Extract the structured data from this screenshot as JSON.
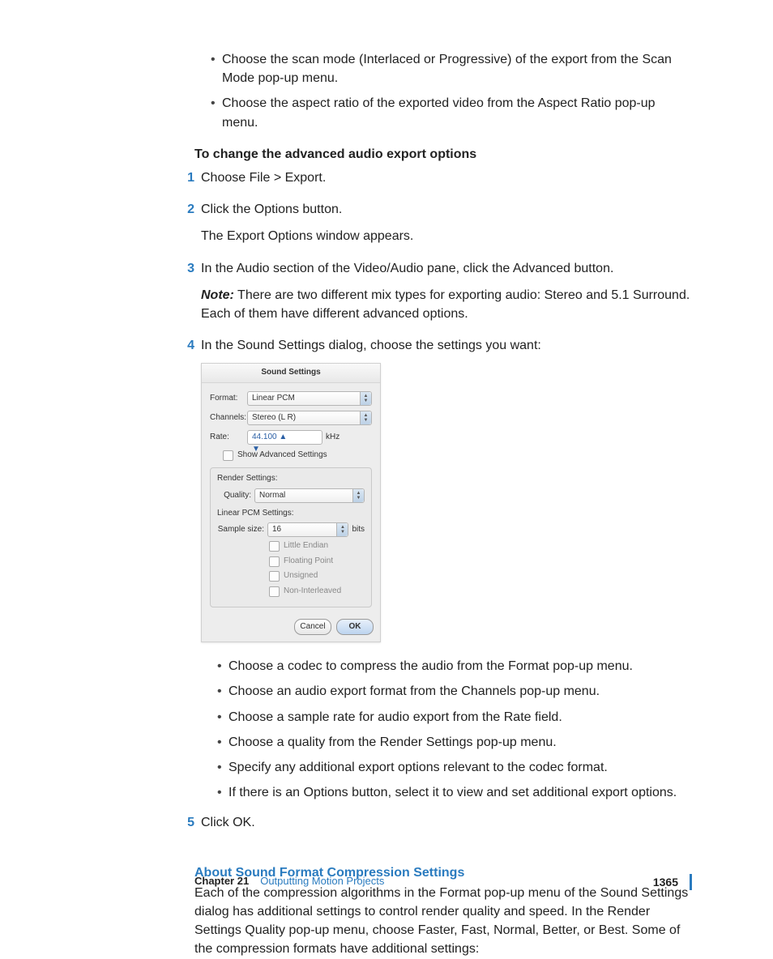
{
  "intro_bullets": [
    "Choose the scan mode (Interlaced or Progressive) of the export from the Scan Mode pop-up menu.",
    "Choose the aspect ratio of the exported video from the Aspect Ratio pop-up menu."
  ],
  "heading_audio": "To change the advanced audio export options",
  "steps": {
    "s1": {
      "num": "1",
      "text": "Choose File > Export."
    },
    "s2": {
      "num": "2",
      "text": "Click the Options button.",
      "after": "The Export Options window appears."
    },
    "s3": {
      "num": "3",
      "text": "In the Audio section of the Video/Audio pane, click the Advanced button.",
      "note_label": "Note:",
      "note_text": "  There are two different mix types for exporting audio: Stereo and 5.1 Surround. Each of them have different advanced options."
    },
    "s4": {
      "num": "4",
      "text": "In the Sound Settings dialog, choose the settings you want:"
    },
    "s5": {
      "num": "5",
      "text": "Click OK."
    }
  },
  "dialog": {
    "title": "Sound Settings",
    "format_label": "Format:",
    "format_value": "Linear PCM",
    "channels_label": "Channels:",
    "channels_value": "Stereo (L R)",
    "rate_label": "Rate:",
    "rate_value": "44.100",
    "rate_unit": "kHz",
    "show_advanced": "Show Advanced Settings",
    "render_group": "Render Settings:",
    "quality_label": "Quality:",
    "quality_value": "Normal",
    "pcm_group": "Linear PCM Settings:",
    "sample_label": "Sample size:",
    "sample_value": "16",
    "sample_unit": "bits",
    "chk_little": "Little Endian",
    "chk_float": "Floating Point",
    "chk_unsigned": "Unsigned",
    "chk_noninter": "Non-Interleaved",
    "cancel": "Cancel",
    "ok": "OK"
  },
  "post_bullets": [
    "Choose a codec to compress the audio from the Format pop-up menu.",
    "Choose an audio export format from the Channels pop-up menu.",
    "Choose a sample rate for audio export from the Rate field.",
    "Choose a quality from the Render Settings pop-up menu.",
    "Specify any additional export options relevant to the codec format.",
    "If there is an Options button, select it to view and set additional export options."
  ],
  "sub_heading": "About Sound Format Compression Settings",
  "sub_paragraph": "Each of the compression algorithms in the Format pop-up menu of the Sound Settings dialog has additional settings to control render quality and speed. In the Render Settings Quality pop-up menu, choose Faster, Fast, Normal, Better, or Best. Some of the compression formats have additional settings:",
  "footer": {
    "chapter": "Chapter 21",
    "title": "Outputting Motion Projects",
    "page": "1365"
  },
  "bullet_char": "•"
}
